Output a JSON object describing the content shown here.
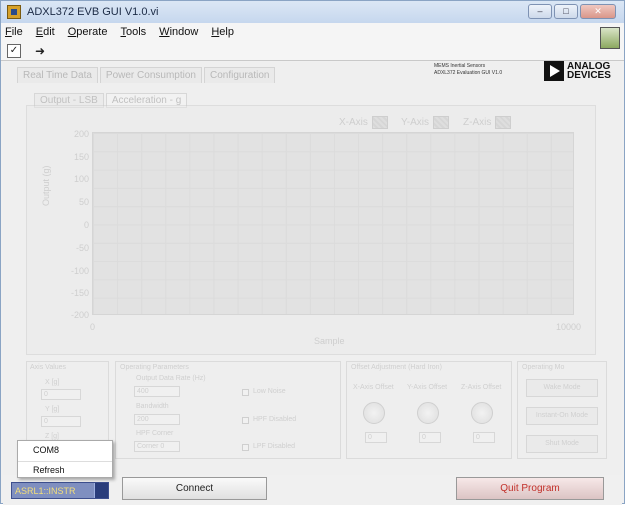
{
  "window": {
    "title": "ADXL372 EVB GUI V1.0.vi",
    "controls": [
      "minimize",
      "maximize",
      "close"
    ]
  },
  "menu": [
    "File",
    "Edit",
    "Operate",
    "Tools",
    "Window",
    "Help"
  ],
  "toolbar": {
    "check": "✓",
    "run": "➜"
  },
  "brand": {
    "line1": "MEMS Inertial Sensors",
    "line2": "ADXL372 Evaluation GUI V1.0",
    "logo": "ANALOG DEVICES"
  },
  "tabs": [
    "Real Time Data",
    "Power Consumption",
    "Configuration"
  ],
  "subtabs": [
    "Output - LSB",
    "Acceleration - g"
  ],
  "legend": [
    "X-Axis",
    "Y-Axis",
    "Z-Axis"
  ],
  "chart_data": {
    "type": "line",
    "ylabel": "Output (g)",
    "xlabel": "Sample",
    "yticks": [
      "200",
      "150",
      "100",
      "50",
      "0",
      "-50",
      "-100",
      "-150",
      "-200"
    ],
    "xticks": [
      "0",
      "10000"
    ],
    "ylim": [
      -200,
      200
    ],
    "xlim": [
      0,
      10000
    ],
    "series": []
  },
  "groups": {
    "axis_values": {
      "title": "Axis Values",
      "labels": [
        "X [g]",
        "Y [g]",
        "Z [g]"
      ],
      "values": [
        "0",
        "0",
        "0"
      ]
    },
    "operating": {
      "title": "Operating Parameters",
      "odr_label": "Output Data Rate (Hz)",
      "odr": "400",
      "bw_label": "Bandwidth",
      "bw": "200",
      "hpf_label": "HPF Corner",
      "hpf": "Corner 0",
      "low_noise": "Low Noise",
      "hpf_disabled": "HPF Disabled",
      "lpf_disabled": "LPF Disabled"
    },
    "offset": {
      "title": "Offset Adjustment (Hard Iron)",
      "labels": [
        "X-Axis Offset",
        "Y-Axis Offset",
        "Z-Axis Offset"
      ],
      "values": [
        "0",
        "0",
        "0"
      ]
    },
    "mode": {
      "title": "Operating Mo",
      "buttons": [
        "Wake Mode",
        "Instant-On Mode",
        "Shut Mode"
      ]
    }
  },
  "popup": {
    "items": [
      "COM8",
      "Refresh"
    ]
  },
  "bottom": {
    "resource": "ASRL1::INSTR",
    "connect": "Connect",
    "quit": "Quit Program"
  }
}
